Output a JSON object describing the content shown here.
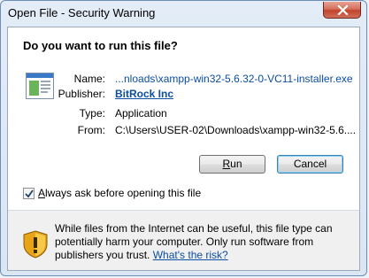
{
  "window": {
    "title": "Open File - Security Warning",
    "close_icon": "close-icon"
  },
  "dialog": {
    "question": "Do you want to run this file?",
    "fields": [
      {
        "label": "Name:",
        "value": "...nloads\\xampp-win32-5.6.32-0-VC11-installer.exe"
      },
      {
        "label": "Publisher:",
        "value": "BitRock Inc"
      },
      {
        "label": "Type:",
        "value": "Application"
      },
      {
        "label": "From:",
        "value": "C:\\Users\\USER-02\\Downloads\\xampp-win32-5.6...."
      }
    ],
    "buttons": {
      "run_prefix": "",
      "run_mnemonic": "R",
      "run_rest": "un",
      "cancel": "Cancel"
    },
    "checkbox": {
      "mnemonic": "A",
      "label_rest": "lways ask before opening this file",
      "checked": true
    },
    "warning": {
      "text": "While files from the Internet can be useful, this file type can potentially harm your computer. Only run software from publishers you trust.",
      "link": "What's the risk?"
    }
  },
  "colors": {
    "link": "#0b4ea2",
    "close_button": "#c2442c"
  }
}
